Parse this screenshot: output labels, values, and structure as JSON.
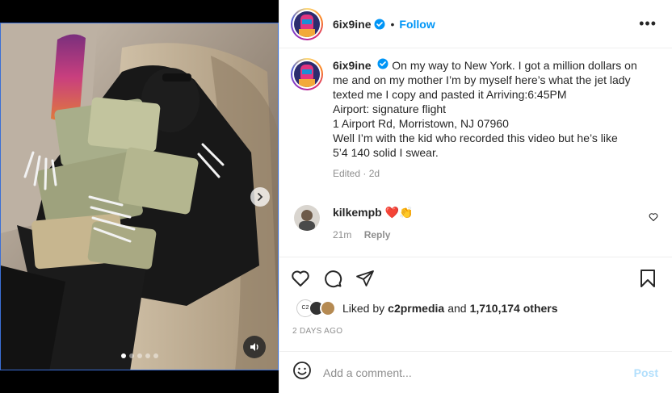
{
  "post": {
    "author": {
      "username": "6ix9ine",
      "verified_icon": "verified-badge-icon",
      "follow_label": "Follow",
      "separator": "•",
      "more_label": "•••"
    },
    "media": {
      "total_slides": 5,
      "active_slide": 1,
      "next_icon": "chevron-right-icon",
      "sound_icon": "speaker-icon"
    },
    "caption": {
      "username": "6ix9ine",
      "lines": [
        "On my way to New York. I got a million dollars on",
        "me and on my mother I’m by myself here’s what the jet lady",
        "texted me I copy and pasted it Arriving:6:45PM",
        "Airport: signature flight",
        "1 Airport Rd, Morristown, NJ 07960",
        "Well I’m with the kid who recorded this video but he’s like",
        "5’4 140 solid I swear."
      ],
      "edited_label": "Edited",
      "dot": "·",
      "age": "2d"
    },
    "comments": [
      {
        "username": "kilkempb",
        "text": "❤️👏",
        "age": "21m",
        "reply_label": "Reply"
      }
    ],
    "actions": {
      "like_icon": "heart-icon",
      "comment_icon": "comment-bubble-icon",
      "share_icon": "paper-plane-icon",
      "save_icon": "bookmark-icon"
    },
    "likes": {
      "prefix": "Liked by",
      "first_user": "c2prmedia",
      "connector": "and",
      "others": "1,710,174 others",
      "avatar_label": "C2"
    },
    "date": "2 DAYS AGO",
    "add_comment": {
      "placeholder": "Add a comment...",
      "post_label": "Post",
      "emoji_icon": "emoji-smile-icon"
    }
  },
  "colors": {
    "accent": "#0095f6",
    "muted": "#8e8e8e",
    "post_disabled": "#b2dffc",
    "heart": "#ed4956"
  }
}
